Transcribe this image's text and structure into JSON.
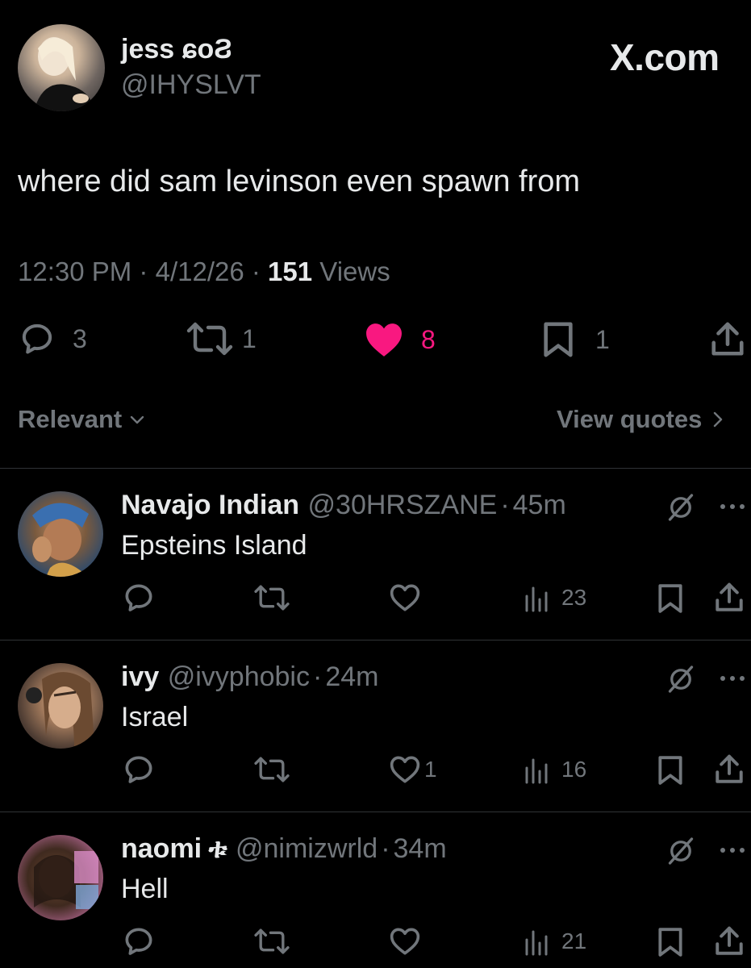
{
  "post": {
    "author_name": "jess ɕoϨ",
    "handle": "@IHYSLVT",
    "brand": "X.com",
    "text": "where did sam levinson even spawn from",
    "time": "12:30 PM",
    "sep1": "·",
    "date": "4/12/26",
    "sep2": "·",
    "views": "151",
    "views_label": "Views",
    "stats": {
      "replies": "3",
      "reposts": "1",
      "likes": "8",
      "bookmarks": "1"
    },
    "like_color": "#f91880"
  },
  "controls": {
    "sort_label": "Relevant",
    "view_quotes_label": "View quotes"
  },
  "replies": [
    {
      "name": "Navajo Indian",
      "handle": "@30HRSZANE",
      "dot": "·",
      "time": "45m",
      "text": "Epsteins Island",
      "likes": "",
      "views": "23"
    },
    {
      "name": "ivy",
      "handle": "@ivyphobic",
      "dot": "·",
      "time": "24m",
      "text": "Israel",
      "likes": "1",
      "views": "16"
    },
    {
      "name": "naomi",
      "badge": "ቱ",
      "handle": "@nimizwrld",
      "dot": "·",
      "time": "34m",
      "text": "Hell",
      "likes": "",
      "views": "21"
    }
  ],
  "icons": [
    "reply-icon",
    "repost-icon",
    "like-icon",
    "bookmark-icon",
    "share-icon",
    "views-icon",
    "grok-icon",
    "more-icon",
    "chevron-down-icon",
    "chevron-right-icon"
  ]
}
